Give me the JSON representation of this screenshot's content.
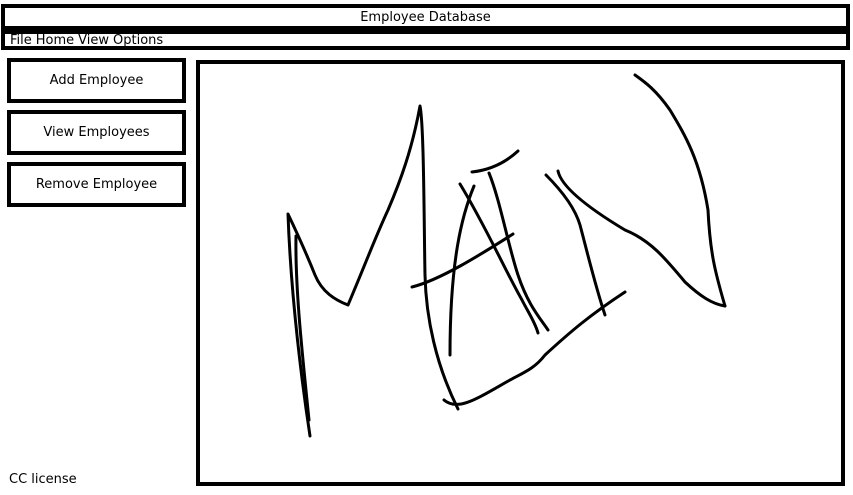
{
  "window": {
    "title": "Employee Database"
  },
  "menu": {
    "items": [
      {
        "label": "File"
      },
      {
        "label": "Home"
      },
      {
        "label": "View"
      },
      {
        "label": "Options"
      }
    ]
  },
  "sidebar": {
    "buttons": [
      {
        "label": "Add Employee"
      },
      {
        "label": "View Employees"
      },
      {
        "label": "Remove Employee"
      }
    ]
  },
  "main": {
    "sketch_text": "MAIN"
  },
  "footer": {
    "text": "CC license"
  },
  "colors": {
    "border": "#000000",
    "background": "#ffffff"
  }
}
